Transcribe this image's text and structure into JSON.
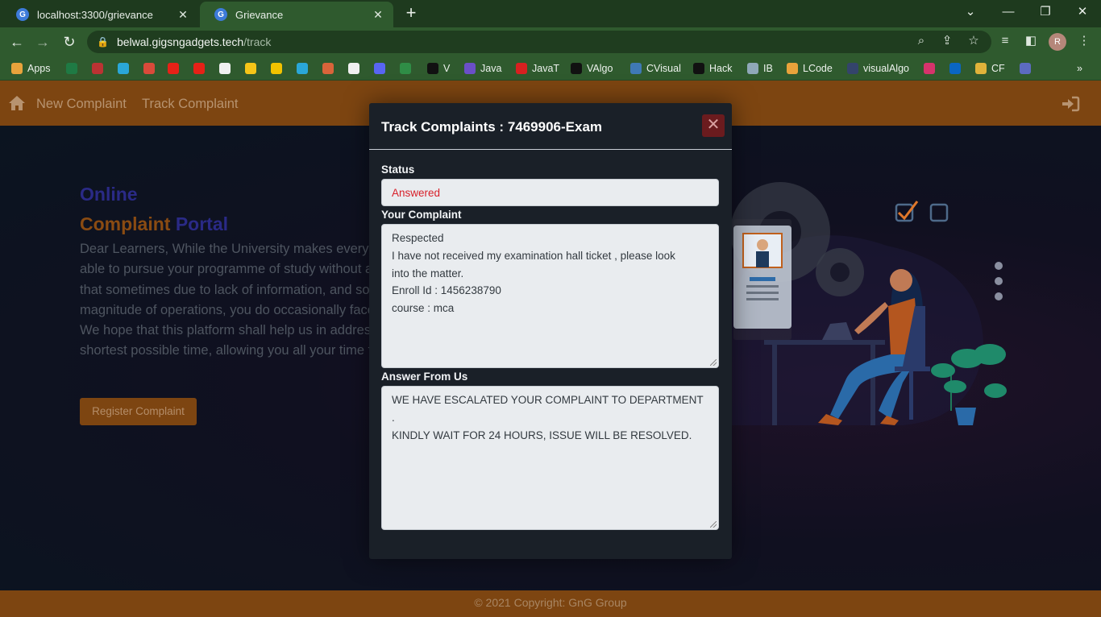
{
  "browser": {
    "tabs": [
      {
        "title": "localhost:3300/grievance"
      },
      {
        "title": "Grievance"
      }
    ],
    "url_host": "belwal.gigsngadgets.tech",
    "url_path": "/track",
    "profile_initial": "R",
    "bookmarks": [
      {
        "label": "Apps",
        "icon": "apps-grid-icon",
        "color": "#e8a33c"
      },
      {
        "label": "",
        "icon": "excel-icon",
        "color": "#1f7a44"
      },
      {
        "label": "",
        "icon": "speedometer-icon",
        "color": "#b33"
      },
      {
        "label": "",
        "icon": "pipe-icon",
        "color": "#2aa7d8"
      },
      {
        "label": "",
        "icon": "gmail-icon",
        "color": "#d94a3a"
      },
      {
        "label": "",
        "icon": "youtube-icon",
        "color": "#e62117"
      },
      {
        "label": "",
        "icon": "youtube-music-icon",
        "color": "#e62117"
      },
      {
        "label": "",
        "icon": "amazon-icon",
        "color": "#f0f0f0"
      },
      {
        "label": "",
        "icon": "flipkart-icon",
        "color": "#f5c518"
      },
      {
        "label": "",
        "icon": "p-icon",
        "color": "#f2c200"
      },
      {
        "label": "",
        "icon": "arrow-icon",
        "color": "#2aa7d8"
      },
      {
        "label": "",
        "icon": "code-icon",
        "color": "#d9643a"
      },
      {
        "label": "",
        "icon": "github-icon",
        "color": "#f0f0f0"
      },
      {
        "label": "",
        "icon": "discord-icon",
        "color": "#5865f2"
      },
      {
        "label": "",
        "icon": "gfg-icon",
        "color": "#2f8d46"
      },
      {
        "label": "V",
        "icon": "v-icon",
        "color": "#111"
      },
      {
        "label": "Java",
        "icon": "java-icon",
        "color": "#6a4fc7"
      },
      {
        "label": "JavaT",
        "icon": "javat-icon",
        "color": "#d82020"
      },
      {
        "label": "VAlgo",
        "icon": "valgo-icon",
        "color": "#111"
      },
      {
        "label": "CVisual",
        "icon": "python-icon",
        "color": "#3f79b5"
      },
      {
        "label": "Hack",
        "icon": "hackerrank-icon",
        "color": "#111"
      },
      {
        "label": "IB",
        "icon": "ib-icon",
        "color": "#8fa8b8"
      },
      {
        "label": "LCode",
        "icon": "leetcode-icon",
        "color": "#e9a33b"
      },
      {
        "label": "visualAlgo",
        "icon": "visualalgo-icon",
        "color": "#34446b"
      },
      {
        "label": "",
        "icon": "instagram-icon",
        "color": "#d6336c"
      },
      {
        "label": "",
        "icon": "linkedin-icon",
        "color": "#0a66c2"
      },
      {
        "label": "CF",
        "icon": "codeforces-icon",
        "color": "#e0b33a"
      },
      {
        "label": "",
        "icon": "link-icon",
        "color": "#5c6bc0"
      }
    ]
  },
  "navbar": {
    "new_complaint": "New Complaint",
    "track_complaint": "Track Complaint"
  },
  "hero": {
    "title_line1": "Online",
    "title_line2_a": "Complaint",
    "title_line2_b": "Portal",
    "text_lines": [
      "Dear Learners, While the University makes every e",
      "able to pursue your programme of study without a",
      "that sometimes due to lack of information, and so",
      "magnitude of operations, you do occasionally face",
      "We hope that this platform shall help us in addres",
      "shortest possible time, allowing you all your time f"
    ],
    "button": "Register Complaint"
  },
  "modal": {
    "title": "Track Complaints : 7469906-Exam",
    "status_label": "Status",
    "status_value": "Answered",
    "complaint_label": "Your Complaint",
    "complaint_value": "Respected\nI have not received my examination hall ticket , please look\ninto the matter.\nEnroll Id : 1456238790\ncourse : mca",
    "answer_label": "Answer From Us",
    "answer_value": "WE HAVE ESCALATED YOUR COMPLAINT TO DEPARTMENT .\nKINDLY WAIT FOR 24 HOURS, ISSUE WILL BE RESOLVED."
  },
  "footer": {
    "copyright": "© 2021 Copyright: GnG Group"
  },
  "colors": {
    "navbar": "#7d4511",
    "status_answered": "#d8202a",
    "close_button": "#6b1b1e"
  }
}
